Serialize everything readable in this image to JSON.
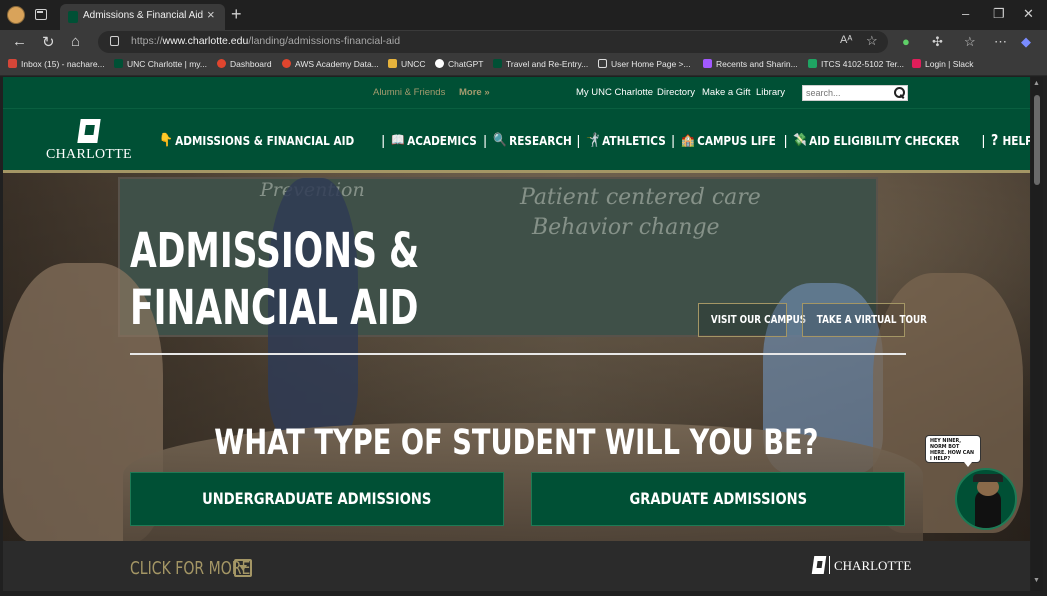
{
  "browser": {
    "tab_title": "Admissions & Financial Aid at the",
    "url_prefix": "https://",
    "url_domain": "www.charlotte.edu",
    "url_path": "/landing/admissions-financial-aid",
    "read_aloud_label": "Aᴬ",
    "bookmarks": [
      {
        "label": "Inbox (15) - nachare...",
        "color": "#d44638"
      },
      {
        "label": "UNC Charlotte | my...",
        "color": "#005035"
      },
      {
        "label": "Dashboard",
        "color": "#e0452e"
      },
      {
        "label": "AWS Academy Data...",
        "color": "#e0452e"
      },
      {
        "label": "UNCC",
        "color": "#e7b33c"
      },
      {
        "label": "ChatGPT",
        "color": "#ffffff"
      },
      {
        "label": "Travel and Re-Entry...",
        "color": "#005035"
      },
      {
        "label": "User Home Page >...",
        "color": "#dddddd"
      },
      {
        "label": "Recents and Sharin...",
        "color": "#a259ff"
      },
      {
        "label": "ITCS 4102-5102 Ter...",
        "color": "#1fa463"
      },
      {
        "label": "Login | Slack",
        "color": "#e01e5a"
      }
    ]
  },
  "utility_nav": {
    "alumni": "Alumni & Friends",
    "more": "More »",
    "links": [
      "My UNC Charlotte",
      "Directory",
      "Make a Gift",
      "Library"
    ],
    "search_placeholder": "search..."
  },
  "logo_text": "CHARLOTTE",
  "main_nav": [
    {
      "icon": "👇",
      "label": "ADMISSIONS & FINANCIAL AID"
    },
    {
      "icon": "📖",
      "label": "ACADEMICS"
    },
    {
      "icon": "🔍",
      "label": "RESEARCH"
    },
    {
      "icon": "🤺",
      "label": "ATHLETICS"
    },
    {
      "icon": "🏫",
      "label": "CAMPUS LIFE"
    },
    {
      "icon": "💸",
      "label": "AID ELIGIBILITY CHECKER"
    },
    {
      "icon": "?",
      "label": "HELP"
    }
  ],
  "hero": {
    "title_line1": "ADMISSIONS &",
    "title_line2": "FINANCIAL AID",
    "visit_button": "VISIT OUR CAMPUS",
    "tour_button": "TAKE A VIRTUAL TOUR",
    "question": "WHAT TYPE OF STUDENT WILL YOU BE?",
    "undergrad_button": "UNDERGRADUATE ADMISSIONS",
    "grad_button": "GRADUATE ADMISSIONS",
    "chalk_line1": "Patient centered care",
    "chalk_line2": "Behavior change",
    "chalk_left": "Prevention"
  },
  "chatbot": {
    "bubble_text": "HEY NINER, NORM BOT HERE. HOW CAN I HELP?"
  },
  "footer": {
    "click_more": "CLICK FOR MORE",
    "logo_text": "CHARLOTTE"
  },
  "colors": {
    "brand_green": "#005035",
    "gold": "#a49665"
  }
}
